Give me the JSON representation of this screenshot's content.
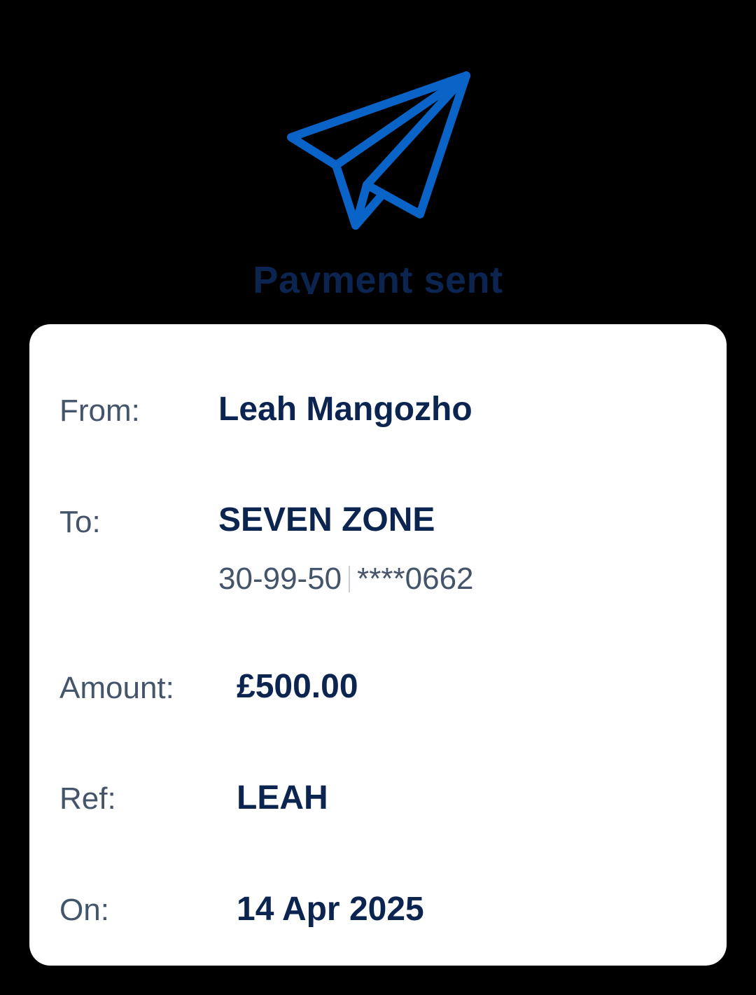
{
  "header": {
    "icon": "paper-plane-icon",
    "title": "Payment sent",
    "accent_color": "#0a64c8",
    "title_color": "#0b2450"
  },
  "details": {
    "from": {
      "label": "From:",
      "value": "Leah Mangozho"
    },
    "to": {
      "label": "To:",
      "value": "SEVEN ZONE",
      "sort_code": "30-99-50",
      "account_number": "****0662"
    },
    "amount": {
      "label": "Amount:",
      "value": "£500.00"
    },
    "ref": {
      "label": "Ref:",
      "value": "LEAH"
    },
    "on": {
      "label": "On:",
      "value": "14 Apr 2025"
    }
  }
}
